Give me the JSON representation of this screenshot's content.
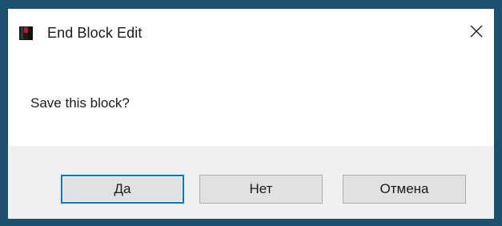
{
  "window": {
    "title": "End Block Edit",
    "app_icon": "book-icon",
    "close_icon": "close-icon",
    "frame_color": "#1c4f70",
    "accent_color": "#0078d7"
  },
  "dialog": {
    "message": "Save this block?"
  },
  "buttons": {
    "yes_label": "Да",
    "no_label": "Нет",
    "cancel_label": "Отмена",
    "default": "yes"
  }
}
